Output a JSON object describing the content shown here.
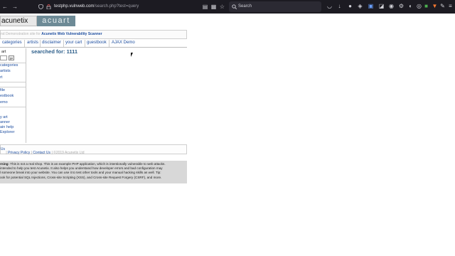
{
  "browser": {
    "nav_buttons": [
      "←",
      "→"
    ],
    "url_host": "testphp.vulnweb.com",
    "url_path": "/search.php?test=query",
    "search_placeholder": "Search",
    "toolbar_icons": [
      "pocket-icon",
      "download-icon",
      "extension-icon",
      "extension-icon",
      "extension-icon",
      "extension-icon",
      "extension-icon",
      "extension-icon",
      "extension-icon",
      "extension-icon",
      "extension-icon",
      "extension-icon",
      "extension-icon",
      "extension-icon",
      "menu-icon"
    ]
  },
  "logo": {
    "left": "acunetix",
    "right": "acuart"
  },
  "tagline": {
    "prefix": "nd Demonstration site for",
    "link": "Acunetix Web Vulnerability Scanner"
  },
  "topnav": [
    "categories",
    "artists",
    "disclaimer",
    "your cart",
    "guestbook",
    "AJAX Demo"
  ],
  "sidebar": {
    "search_label": "art",
    "go_label": "go",
    "links_top": [
      "categories",
      "artists",
      "rt"
    ],
    "links_mid": [
      "file",
      "estbook",
      "emo"
    ],
    "links_bottom": [
      "y art",
      "anner",
      "ain help",
      "Explorer"
    ]
  },
  "main": {
    "result": "searched for: 1111"
  },
  "footer": {
    "links": [
      "About Us",
      "Privacy Policy",
      "Contact Us"
    ],
    "copyright": "©2019 Acunetix Ltd"
  },
  "warning": {
    "lead": "rning:",
    "lines": [
      " This is not a real shop. This is an example PHP application, which is intentionally vulnerable to web attacks.",
      "intended to help you test Acunetix. It also helps you understand how developer errors and bad configuration may",
      "l someone break into your website. You can use it to test other tools and your manual hacking skills as well. Tip:",
      "ook for potential SQL Injections, Cross-site Scripting (XSS), and Cross-site Request Forgery (CSRF), and more."
    ]
  }
}
